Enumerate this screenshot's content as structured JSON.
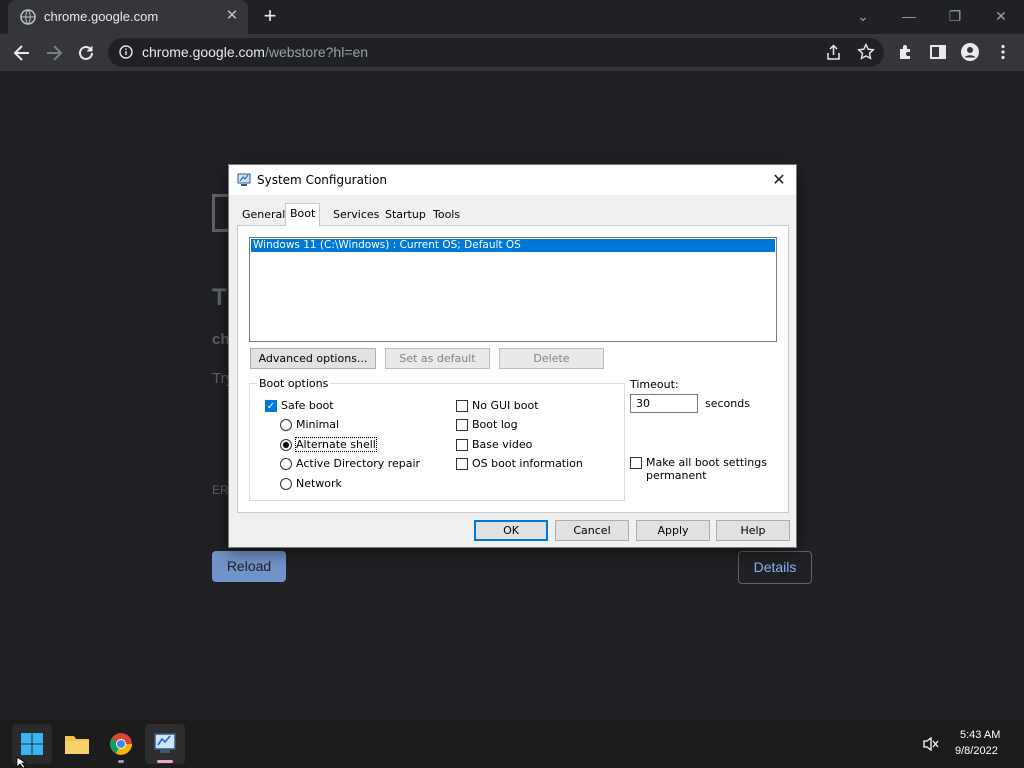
{
  "browser": {
    "tab_title": "chrome.google.com",
    "url_host": "chrome.google.com",
    "url_path": "/webstore?hl=en",
    "tab_close": "✕",
    "new_tab": "+"
  },
  "page": {
    "heading": "Th",
    "host": "ch",
    "try_text": "Try",
    "error_code": "ERR",
    "reload_label": "Reload",
    "details_label": "Details"
  },
  "dialog": {
    "title": "System Configuration",
    "close": "✕",
    "tabs": [
      "General",
      "Boot",
      "Services",
      "Startup",
      "Tools"
    ],
    "active_tab": "Boot",
    "os_entries": [
      "Windows 11 (C:\\Windows) : Current OS; Default OS"
    ],
    "buttons": {
      "advanced": "Advanced options...",
      "set_default": "Set as default",
      "delete": "Delete",
      "ok": "OK",
      "cancel": "Cancel",
      "apply": "Apply",
      "help": "Help"
    },
    "boot_options": {
      "legend": "Boot options",
      "safe_boot": "Safe boot",
      "minimal": "Minimal",
      "alternate_shell": "Alternate shell",
      "ad_repair": "Active Directory repair",
      "network": "Network",
      "no_gui": "No GUI boot",
      "boot_log": "Boot log",
      "base_video": "Base video",
      "os_boot_info": "OS boot information"
    },
    "timeout": {
      "label": "Timeout:",
      "value": "30",
      "unit": "seconds"
    },
    "permanent": {
      "line1": "Make all boot settings",
      "line2": "permanent"
    }
  },
  "taskbar": {
    "time": "5:43 AM",
    "date": "9/8/2022"
  },
  "colors": {
    "accent": "#0078d7",
    "chrome_bg": "#202124",
    "chrome_toolbar": "#35363a"
  }
}
